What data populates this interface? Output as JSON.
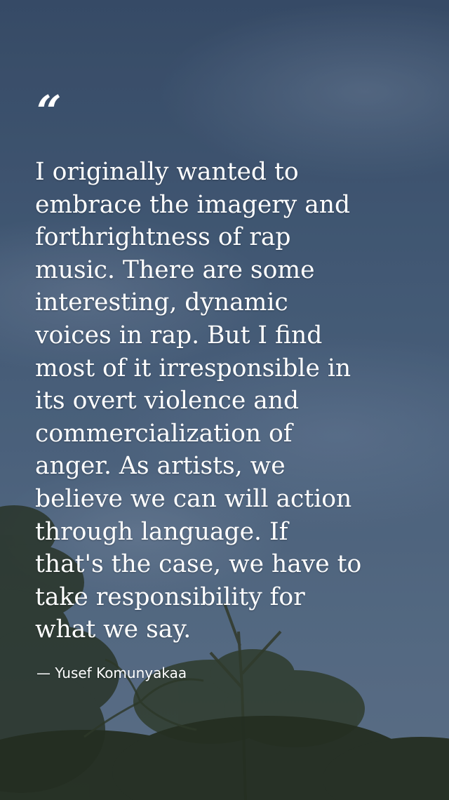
{
  "background": {
    "description_colors": [
      "#3e5573",
      "#56708d",
      "#6a8099"
    ],
    "foliage_color": "#2f3a26"
  },
  "quote": {
    "mark": "“",
    "text": "I originally wanted to\nembrace the imagery and\nforthrightness of rap\nmusic. There are some\ninteresting, dynamic\nvoices in rap. But I find\nmost of it irresponsible in\nits overt violence and\ncommercialization of\nanger. As artists, we\nbelieve we can will action\nthrough language. If\nthat's the case, we have to\ntake responsibility for\nwhat we say.",
    "author": "— Yusef Komunyakaa"
  }
}
